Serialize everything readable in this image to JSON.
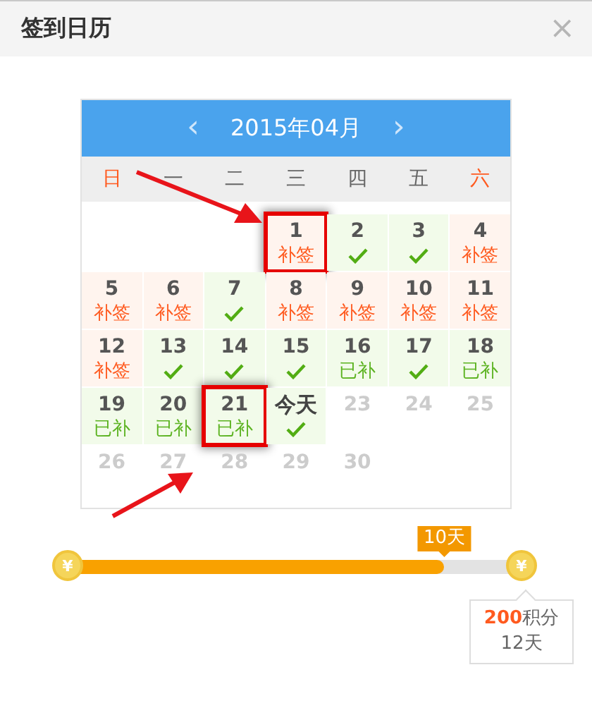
{
  "window": {
    "title": "签到日历",
    "close": "×"
  },
  "calendar": {
    "prev": "‹",
    "month": "2015年04月",
    "next": "›",
    "weekdays": [
      {
        "label": "日",
        "weekend": true
      },
      {
        "label": "一",
        "weekend": false
      },
      {
        "label": "二",
        "weekend": false
      },
      {
        "label": "三",
        "weekend": false
      },
      {
        "label": "四",
        "weekend": false
      },
      {
        "label": "五",
        "weekend": false
      },
      {
        "label": "六",
        "weekend": true
      }
    ],
    "weeks": [
      [
        {
          "kind": "blank"
        },
        {
          "kind": "blank"
        },
        {
          "kind": "blank"
        },
        {
          "day": "1",
          "kind": "makeup",
          "mark": "补签",
          "highlighted": true
        },
        {
          "day": "2",
          "kind": "signed",
          "highlighted": false
        },
        {
          "day": "3",
          "kind": "signed",
          "highlighted": false
        },
        {
          "day": "4",
          "kind": "makeup",
          "mark": "补签",
          "highlighted": false
        }
      ],
      [
        {
          "day": "5",
          "kind": "makeup",
          "mark": "补签",
          "highlighted": false
        },
        {
          "day": "6",
          "kind": "makeup",
          "mark": "补签",
          "highlighted": false
        },
        {
          "day": "7",
          "kind": "signed",
          "highlighted": false
        },
        {
          "day": "8",
          "kind": "makeup",
          "mark": "补签",
          "highlighted": false
        },
        {
          "day": "9",
          "kind": "makeup",
          "mark": "补签",
          "highlighted": false
        },
        {
          "day": "10",
          "kind": "makeup",
          "mark": "补签",
          "highlighted": false
        },
        {
          "day": "11",
          "kind": "makeup",
          "mark": "补签",
          "highlighted": false
        }
      ],
      [
        {
          "day": "12",
          "kind": "makeup",
          "mark": "补签",
          "highlighted": false
        },
        {
          "day": "13",
          "kind": "signed",
          "highlighted": false
        },
        {
          "day": "14",
          "kind": "signed",
          "highlighted": false
        },
        {
          "day": "15",
          "kind": "signed",
          "highlighted": false
        },
        {
          "day": "16",
          "kind": "redone",
          "mark": "已补",
          "highlighted": false
        },
        {
          "day": "17",
          "kind": "signed",
          "highlighted": false
        },
        {
          "day": "18",
          "kind": "redone",
          "mark": "已补",
          "highlighted": false
        }
      ],
      [
        {
          "day": "19",
          "kind": "redone",
          "mark": "已补",
          "highlighted": false
        },
        {
          "day": "20",
          "kind": "redone",
          "mark": "已补",
          "highlighted": false
        },
        {
          "day": "21",
          "kind": "redone",
          "mark": "已补",
          "highlighted": true
        },
        {
          "day": "今天",
          "kind": "today",
          "highlighted": false
        },
        {
          "day": "23",
          "kind": "future",
          "highlighted": false
        },
        {
          "day": "24",
          "kind": "future",
          "highlighted": false
        },
        {
          "day": "25",
          "kind": "future",
          "highlighted": false
        }
      ],
      [
        {
          "day": "26",
          "kind": "future",
          "highlighted": false
        },
        {
          "day": "27",
          "kind": "future",
          "highlighted": false
        },
        {
          "day": "28",
          "kind": "future",
          "highlighted": false
        },
        {
          "day": "29",
          "kind": "future",
          "highlighted": false
        },
        {
          "day": "30",
          "kind": "future",
          "highlighted": false
        },
        {
          "kind": "blank"
        },
        {
          "kind": "blank"
        }
      ]
    ]
  },
  "progress": {
    "level": 0.83,
    "current": "10天",
    "start_coin": "¥",
    "end_coin": "¥",
    "reward_points": "200",
    "reward_unit": "积分",
    "reward_days": "12天"
  }
}
